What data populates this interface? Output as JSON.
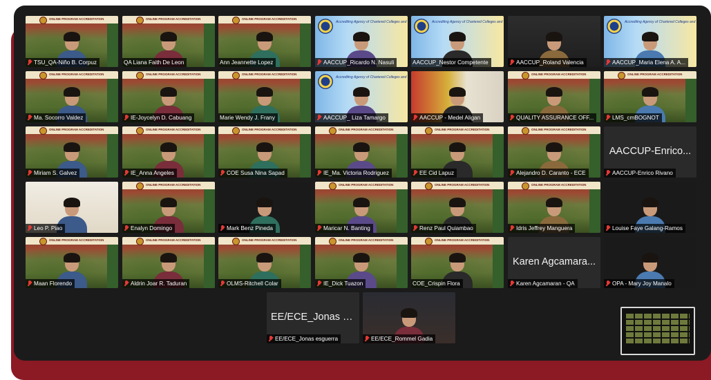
{
  "colors": {
    "frame": "#8b1a24",
    "window": "#1b1b1b",
    "active_speaker": "#37d04a",
    "muted": "#e53935"
  },
  "banner": {
    "title": "ONLINE PROGRAM ACCREDITATION"
  },
  "aaccup_banner": "Accrediting Agency of Chartered Colleges and Universities in the Philippines",
  "participants": [
    {
      "name": "TSU_QA-Niño B. Corpuz",
      "muted": true,
      "bg": "campus"
    },
    {
      "name": "QA Liana Faith De Leon",
      "muted": false,
      "bg": "campus",
      "active": true
    },
    {
      "name": "Ann Jeannette Lopez",
      "muted": false,
      "bg": "campus"
    },
    {
      "name": "AACCUP_Ricardo N. Nasuli",
      "muted": true,
      "bg": "aaccup"
    },
    {
      "name": "AACCUP_Nestor Competente",
      "muted": false,
      "bg": "aaccup"
    },
    {
      "name": "AACCUP_Roland Valencia",
      "muted": true,
      "bg": "portrait"
    },
    {
      "name": "AACCUP_Maria Elena A. A...",
      "muted": true,
      "bg": "aaccup"
    },
    {
      "name": "Ma. Socorro Valdez",
      "muted": true,
      "bg": "campus"
    },
    {
      "name": "IE-Joycelyn D. Cabuang",
      "muted": true,
      "bg": "campus"
    },
    {
      "name": "Marie Wendy J. Frany",
      "muted": false,
      "bg": "campus"
    },
    {
      "name": "AACCUP_ Liza Tamargo",
      "muted": true,
      "bg": "aaccup"
    },
    {
      "name": "AACCUP - Medel Aligan",
      "muted": true,
      "bg": "redoffice"
    },
    {
      "name": "QUALITY ASSURANCE OFF...",
      "muted": true,
      "bg": "campus"
    },
    {
      "name": "LMS_cmBOGNOT",
      "muted": true,
      "bg": "campus"
    },
    {
      "name": "Miriam S. Galvez",
      "muted": true,
      "bg": "campus"
    },
    {
      "name": "IE_Anna Angeles",
      "muted": true,
      "bg": "campus"
    },
    {
      "name": "COE Susa Nina Sapad",
      "muted": true,
      "bg": "campus"
    },
    {
      "name": "IE_Ma. Victoria Rodriguez",
      "muted": true,
      "bg": "campus"
    },
    {
      "name": "EE Cid Lapuz",
      "muted": true,
      "bg": "campus"
    },
    {
      "name": "Alejandro D. Caranto - ECE",
      "muted": true,
      "bg": "campus"
    },
    {
      "name": "AACCUP-Enrico Rivano",
      "muted": true,
      "bg": "none",
      "big": "AACCUP-Enrico..."
    },
    {
      "name": "Leo P. Piao",
      "muted": true,
      "bg": "room"
    },
    {
      "name": "Enalyn Domingo",
      "muted": true,
      "bg": "campus"
    },
    {
      "name": "Mark Benz Pineda",
      "muted": true,
      "bg": "black"
    },
    {
      "name": "Maricar N. Banting",
      "muted": true,
      "bg": "campus"
    },
    {
      "name": "Renz Paul Quiambao",
      "muted": true,
      "bg": "campus"
    },
    {
      "name": "Idris Jeffrey Manguera",
      "muted": true,
      "bg": "campus"
    },
    {
      "name": "Louise Faye Galang-Ramos",
      "muted": true,
      "bg": "black"
    },
    {
      "name": "Maan Florendo",
      "muted": true,
      "bg": "campus"
    },
    {
      "name": "Aldrin Joar R. Taduran",
      "muted": true,
      "bg": "campus"
    },
    {
      "name": "OLMS-Ritchell Colar",
      "muted": true,
      "bg": "campus"
    },
    {
      "name": "IE_Dick Tuazon",
      "muted": true,
      "bg": "campus"
    },
    {
      "name": "COE_Crispin Flora",
      "muted": false,
      "bg": "campus"
    },
    {
      "name": "Karen Agcamaran - QA",
      "muted": true,
      "bg": "none",
      "big": "Karen Agcamara..."
    },
    {
      "name": "OPA - Mary Joy Manalo",
      "muted": true,
      "bg": "black"
    },
    {
      "name": "EE/ECE_Jonas esguerra",
      "muted": true,
      "bg": "none",
      "big": "EE/ECE_Jonas e..."
    },
    {
      "name": "EE/ECE_Rommel Gadia",
      "muted": true,
      "bg": "grad"
    }
  ]
}
